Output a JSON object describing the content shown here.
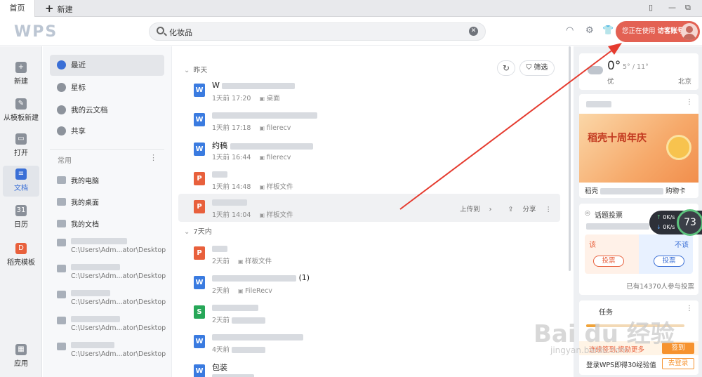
{
  "tabbar": {
    "home": "首页",
    "new_tab": "新建"
  },
  "header": {
    "logo": "WPS",
    "search_value": "化妆品",
    "user_pill_prefix": "您正在使用",
    "user_pill_account": "访客账号"
  },
  "leftnav": [
    {
      "label": "新建",
      "icon": "plus-icon"
    },
    {
      "label": "从模板新建",
      "icon": "template-icon"
    },
    {
      "label": "打开",
      "icon": "folder-icon"
    },
    {
      "label": "文档",
      "icon": "document-icon",
      "active": true
    },
    {
      "label": "日历",
      "icon": "calendar-icon"
    },
    {
      "label": "稻壳模板",
      "icon": "docer-icon"
    },
    {
      "label": "应用",
      "icon": "apps-icon"
    }
  ],
  "col2": {
    "items": [
      {
        "label": "最近",
        "active": true
      },
      {
        "label": "星标"
      },
      {
        "label": "我的云文档"
      },
      {
        "label": "共享"
      }
    ],
    "section": "常用",
    "favorites": [
      {
        "label": "我的电脑"
      },
      {
        "label": "我的桌面"
      },
      {
        "label": "我的文档"
      }
    ],
    "paths": [
      {
        "path": "C:\\Users\\Adm...ator\\Desktop"
      },
      {
        "path": "C:\\Users\\Adm...ator\\Desktop"
      },
      {
        "path": "C:\\Users\\Adm...ator\\Desktop"
      },
      {
        "path": "C:\\Users\\Adm...ator\\Desktop"
      },
      {
        "path": "C:\\Users\\Adm...ator\\Desktop"
      }
    ]
  },
  "main": {
    "group_yesterday": "昨天",
    "group_week": "7天内",
    "filter": "筛选",
    "files": [
      {
        "type": "W",
        "name": "W",
        "time": "1天前 17:20",
        "loc": "桌面"
      },
      {
        "type": "W",
        "name": "",
        "time": "1天前 17:18",
        "loc": "filerecv"
      },
      {
        "type": "W",
        "name": "约稿",
        "time": "1天前 16:44",
        "loc": "filerecv"
      },
      {
        "type": "P",
        "name": "",
        "time": "1天前 14:48",
        "loc": "样板文件"
      },
      {
        "type": "P",
        "name": "",
        "time": "1天前 14:04",
        "loc": "样板文件",
        "upload": "上传到",
        "share": "分享"
      },
      {
        "type": "P",
        "name": "",
        "time": "2天前",
        "loc": "样板文件"
      },
      {
        "type": "W",
        "name": "",
        "suffix": "(1)",
        "time": "2天前",
        "loc": "FileRecv"
      },
      {
        "type": "S",
        "name": "",
        "time": "2天前",
        "loc": ""
      },
      {
        "type": "W",
        "name": "",
        "time": "4天前",
        "loc": ""
      },
      {
        "type": "W",
        "name": "包装",
        "time": "",
        "loc": ""
      }
    ]
  },
  "right": {
    "weather": {
      "temp": "0°",
      "range": "5° / 11°",
      "aq": "优",
      "city": "北京"
    },
    "promo_title": "稻壳十周年庆",
    "promo_foot_a": "稻壳",
    "promo_foot_b": "购物卡",
    "vote_title": "话题投票",
    "vote_left": "该",
    "vote_right": "不该",
    "vote_btn": "投票",
    "vote_count": "已有14370人参与投票",
    "task_title": "任务",
    "checkin_text": "连续签到,奖励更多",
    "checkin_btn": "签到",
    "login_text": "登录WPS即得30经验值",
    "login_btn": "去登录",
    "net_up": "0K/s",
    "net_down": "0K/s",
    "net_value": "73"
  },
  "watermark": {
    "main": "Bai du 经验",
    "sub": "jingyan.baidu.com"
  }
}
